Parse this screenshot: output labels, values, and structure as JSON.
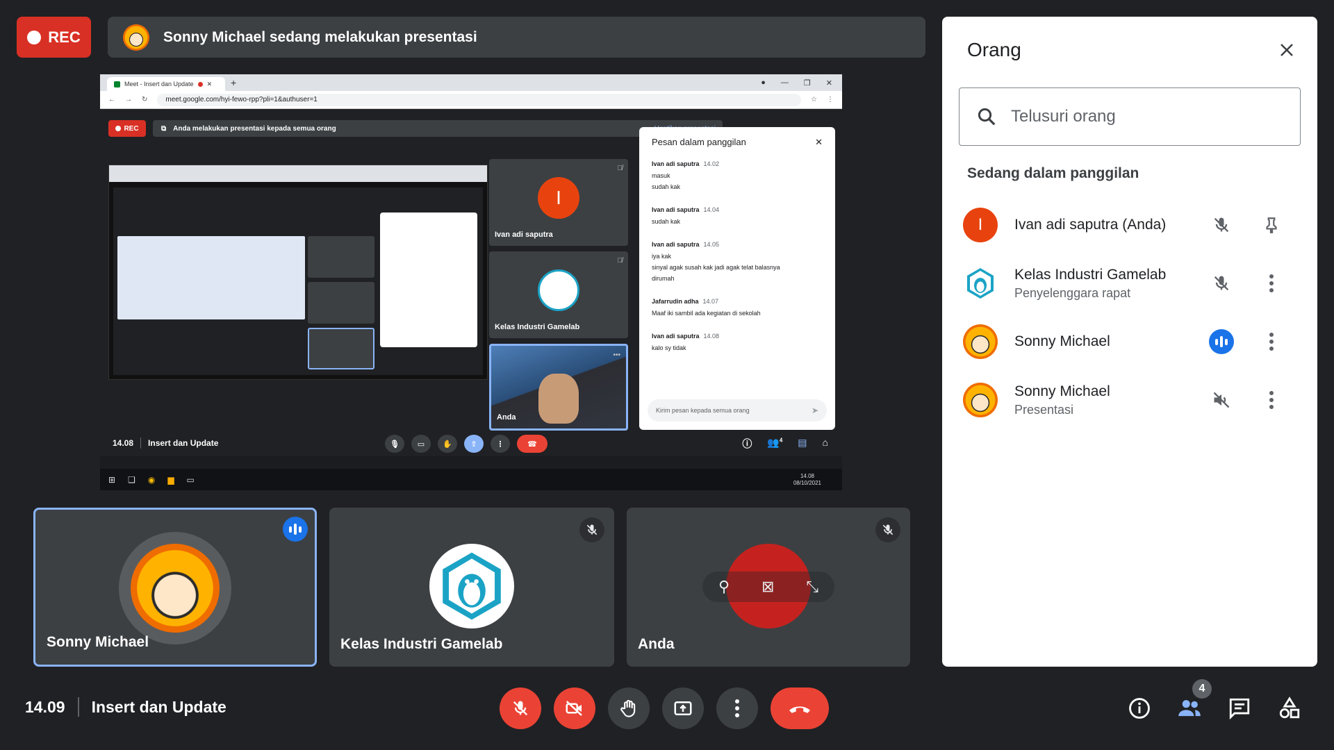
{
  "recording": {
    "label": "REC"
  },
  "presentation_banner": {
    "text": "Sonny Michael sedang melakukan presentasi"
  },
  "shared_screen": {
    "browser": {
      "tab_title": "Meet - Insert dan Update",
      "url": "meet.google.com/hyi-fewo-rpp?pli=1&authuser=1"
    },
    "meet": {
      "rec_label": "REC",
      "banner_text": "Anda melakukan presentasi kepada semua orang",
      "stop_label": "Hentikan presentasi",
      "tiles": [
        {
          "name": "Ivan adi saputra",
          "initial": "I"
        },
        {
          "name": "Kelas Industri Gamelab"
        },
        {
          "name": "Anda"
        }
      ],
      "chat": {
        "title": "Pesan dalam panggilan",
        "messages": [
          {
            "sender": "Ivan adi saputra",
            "time": "14.02",
            "text": "masuk\nsudah kak"
          },
          {
            "sender": "Ivan adi saputra",
            "time": "14.04",
            "text": "sudah kak"
          },
          {
            "sender": "Ivan adi saputra",
            "time": "14.05",
            "text": "iya kak\nsinyal agak susah kak jadi agak telat balasnya\ndirumah"
          },
          {
            "sender": "Jafarrudin adha",
            "time": "14.07",
            "text": "Maaf iki sambil ada kegiatan di sekolah"
          },
          {
            "sender": "Ivan adi saputra",
            "time": "14.08",
            "text": "kalo sy tidak"
          }
        ],
        "input_placeholder": "Kirim pesan kepada semua orang"
      },
      "bottom": {
        "time": "14.08",
        "meeting_title": "Insert dan Update",
        "people_count": "4"
      }
    },
    "taskbar": {
      "time": "14.08",
      "date": "08/10/2021"
    }
  },
  "tiles": [
    {
      "name": "Sonny Michael",
      "state": "speaking"
    },
    {
      "name": "Kelas Industri Gamelab",
      "state": "muted"
    },
    {
      "name": "Anda",
      "state": "muted"
    }
  ],
  "people_panel": {
    "title": "Orang",
    "search_placeholder": "Telusuri orang",
    "section_title": "Sedang dalam panggilan",
    "participants": [
      {
        "name": "Ivan adi saputra (Anda)",
        "subtitle": "",
        "initial": "I",
        "status": "mic-off",
        "action": "pin"
      },
      {
        "name": "Kelas Industri Gamelab",
        "subtitle": "Penyelenggara rapat",
        "status": "mic-off",
        "action": "more"
      },
      {
        "name": "Sonny Michael",
        "subtitle": "",
        "status": "speaking",
        "action": "more"
      },
      {
        "name": "Sonny Michael",
        "subtitle": "Presentasi",
        "status": "audio-off",
        "action": "more"
      }
    ]
  },
  "bottom_bar": {
    "time": "14.09",
    "meeting_title": "Insert dan Update",
    "people_count": "4"
  },
  "colors": {
    "accent": "#1a73e8",
    "danger": "#ea4335",
    "rec": "#d93025",
    "background": "#202124",
    "tile": "#3c4043"
  }
}
